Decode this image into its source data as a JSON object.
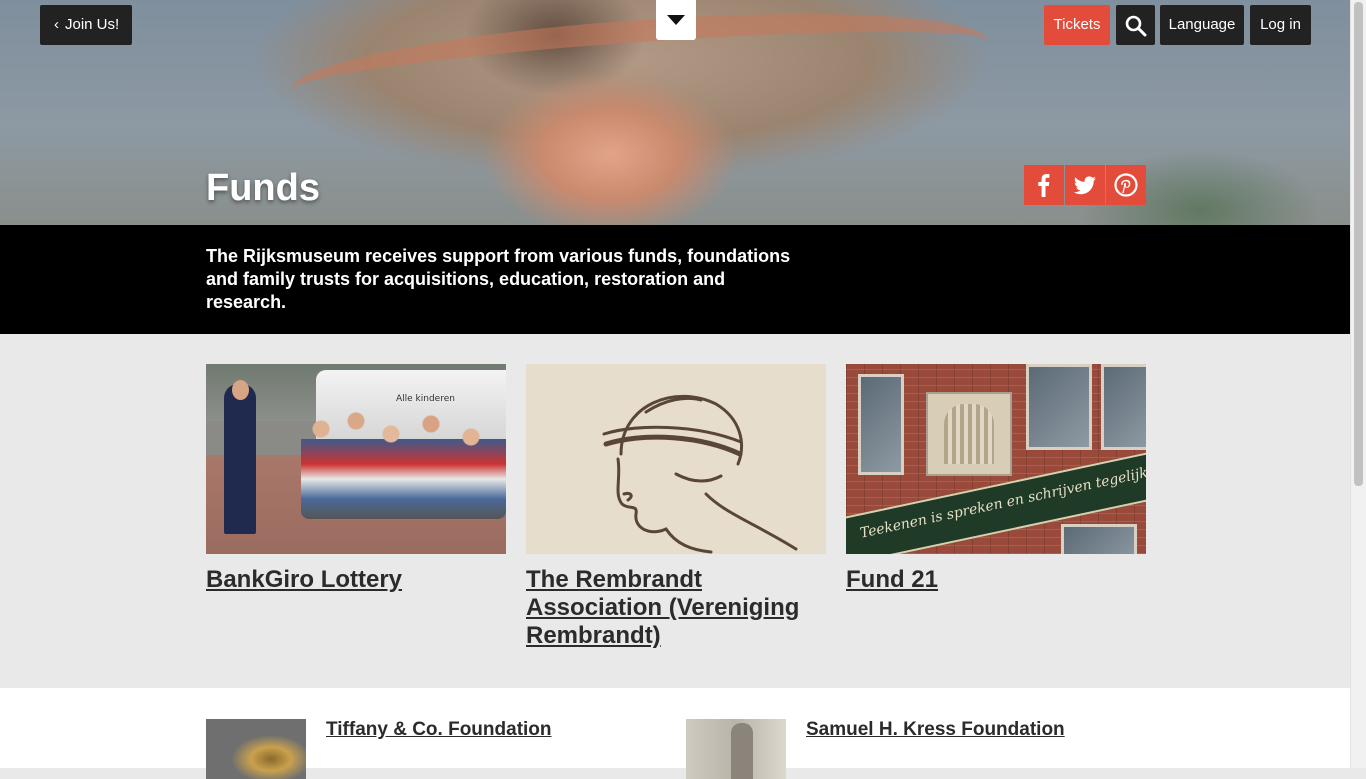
{
  "nav": {
    "join_label": "Join Us!",
    "tickets_label": "Tickets",
    "language_label": "Language",
    "login_label": "Log in"
  },
  "hero": {
    "title": "Funds"
  },
  "intro": {
    "text": "The Rijksmuseum receives support from various funds, foundations and family trusts for acquisitions, education, restoration and research."
  },
  "funds": [
    {
      "title": "BankGiro Lottery",
      "image_text": "Alle kinderen"
    },
    {
      "title": "The Rembrandt Association (Vereniging Rembrandt)"
    },
    {
      "title": "Fund 21",
      "image_text": "Teekenen is spreken en schrijven tegelijk"
    }
  ],
  "lower_links": [
    {
      "title": "Tiffany & Co. Foundation"
    },
    {
      "title": "Samuel H. Kress Foundation"
    }
  ],
  "colors": {
    "accent": "#e34c3a",
    "button_dark": "#222222",
    "intro_band": "#000000",
    "cards_bg": "#e9e9e9"
  },
  "icons": [
    "chevron-left-icon",
    "caret-down-icon",
    "search-icon",
    "facebook-icon",
    "twitter-icon",
    "pinterest-icon"
  ]
}
